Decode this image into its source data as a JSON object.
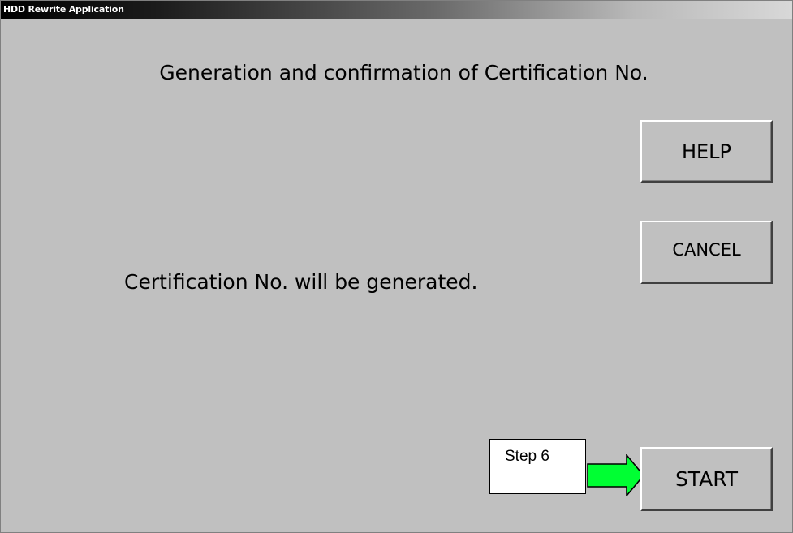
{
  "window": {
    "title": "HDD Rewrite Application"
  },
  "main": {
    "heading": "Generation and confirmation of Certification No.",
    "message": "Certification No. will be generated."
  },
  "buttons": {
    "help_label": "HELP",
    "cancel_label": "CANCEL",
    "start_label": "START"
  },
  "annotation": {
    "step_label": "Step 6",
    "arrow_icon": "right-arrow-icon",
    "arrow_color": "#00ff33"
  },
  "colors": {
    "window_background": "#c0c0c0"
  }
}
